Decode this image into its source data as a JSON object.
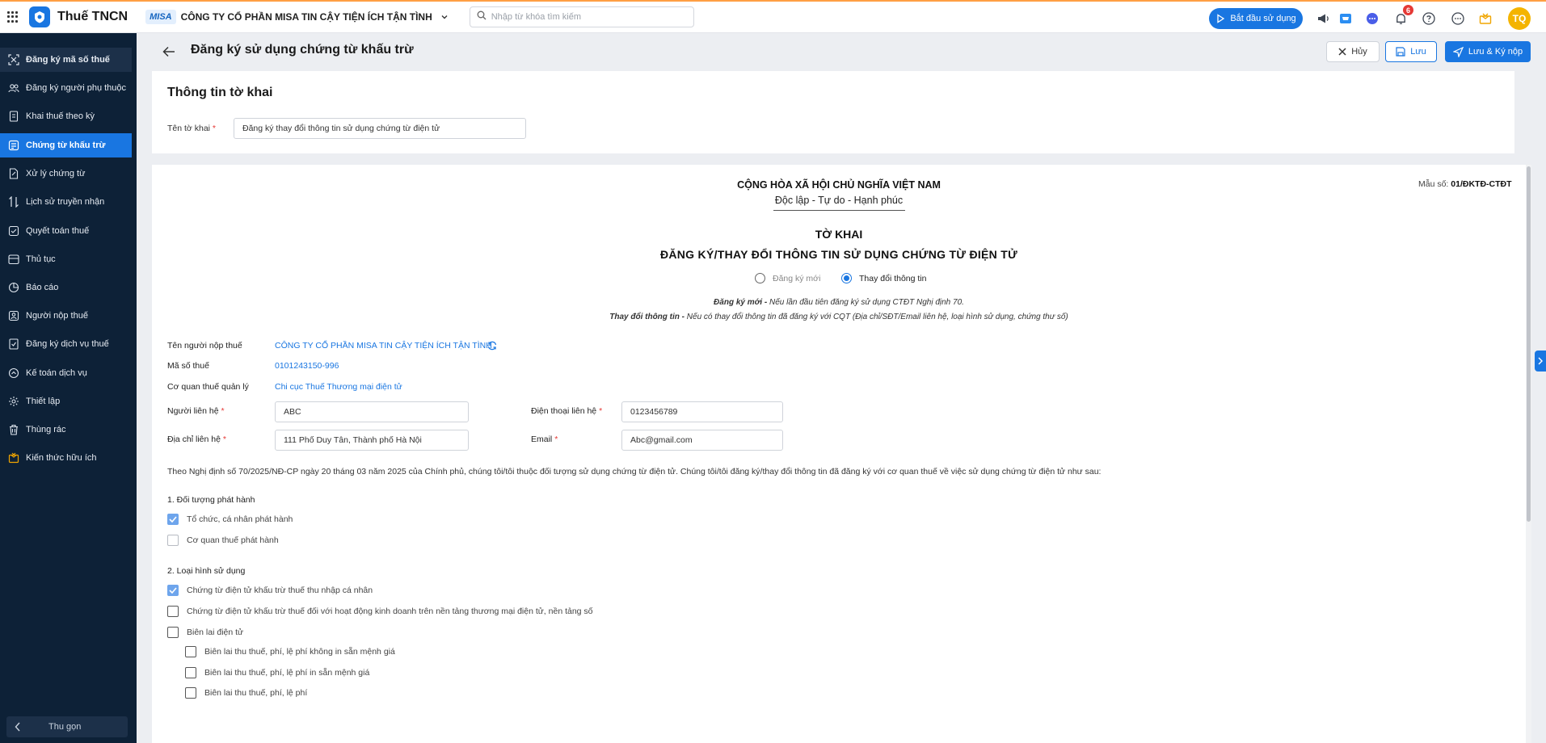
{
  "app": {
    "name": "Thuế TNCN",
    "brand_tag": "MISA",
    "company": "CÔNG TY CỔ PHẦN MISA TIN CẬY TIỆN ÍCH TẬN TÌNH",
    "search_placeholder": "Nhập từ khóa tìm kiếm",
    "start_button": "Bắt đầu sử dụng",
    "notification_count": "6",
    "avatar_initials": "TQ",
    "accent_color": "#1976e1"
  },
  "sidebar": {
    "items": [
      {
        "label": "Đăng ký mã số thuế",
        "icon": "id-card-icon"
      },
      {
        "label": "Đăng ký người phụ thuộc",
        "icon": "users-icon"
      },
      {
        "label": "Khai thuế theo kỳ",
        "icon": "document-icon"
      },
      {
        "label": "Chứng từ khấu trừ",
        "icon": "receipt-icon"
      },
      {
        "label": "Xử lý chứng từ",
        "icon": "file-edit-icon"
      },
      {
        "label": "Lịch sử truyền nhận",
        "icon": "transfer-icon"
      },
      {
        "label": "Quyết toán thuế",
        "icon": "settlement-icon"
      },
      {
        "label": "Thủ tục",
        "icon": "folder-icon"
      },
      {
        "label": "Báo cáo",
        "icon": "chart-icon"
      },
      {
        "label": "Người nộp thuế",
        "icon": "person-icon"
      },
      {
        "label": "Đăng ký dịch vụ thuế",
        "icon": "service-icon"
      },
      {
        "label": "Kế toán dịch vụ",
        "icon": "accounting-icon"
      },
      {
        "label": "Thiết lập",
        "icon": "gear-icon"
      },
      {
        "label": "Thùng rác",
        "icon": "trash-icon"
      },
      {
        "label": "Kiến thức hữu ích",
        "icon": "knowledge-icon"
      }
    ],
    "collapse_label": "Thu gọn"
  },
  "header": {
    "title": "Đăng ký sử dụng chứng từ khấu trừ",
    "cancel": "Hủy",
    "save": "Lưu",
    "save_sign": "Lưu & Ký nộp"
  },
  "info": {
    "title": "Thông tin tờ khai",
    "name_label": "Tên tờ khai",
    "name_value": "Đăng ký thay đổi thông tin sử dụng chứng từ điện tử"
  },
  "form": {
    "nation": "CỘNG HÒA XÃ HỘI CHỦ NGHĨA VIỆT NAM",
    "motto": "Độc lập - Tự do - Hạnh phúc",
    "form_code_label": "Mẫu số:",
    "form_code": "01/ĐKTĐ-CTĐT",
    "title": "TỜ KHAI",
    "subtitle": "ĐĂNG KÝ/THAY ĐỔI THÔNG TIN SỬ DỤNG CHỨNG TỪ ĐIỆN TỬ",
    "radio_new": "Đăng ký mới",
    "radio_change": "Thay đổi thông tin",
    "note1_bold": "Đăng ký mới -",
    "note1": "Nếu lần đầu tiên đăng ký sử dụng CTĐT Nghị định 70.",
    "note2_bold": "Thay đổi thông tin -",
    "note2": "Nếu có thay đổi thông tin đã đăng ký với CQT (Địa chỉ/SĐT/Email liên hệ, loại hình sử dụng, chứng thư số)",
    "taxpayer_label": "Tên người nộp thuế",
    "taxpayer_value": "CÔNG TY CỔ PHẦN MISA TIN CẬY TIỆN ÍCH TẬN TÌNH",
    "tax_code_label": "Mã số thuế",
    "tax_code_value": "0101243150-996",
    "authority_label": "Cơ quan thuế quản lý",
    "authority_value": "Chi cục Thuế Thương mại điện tử",
    "contact_label": "Người liên hệ",
    "contact_value": "ABC",
    "phone_label": "Điện thoại liên hệ",
    "phone_value": "0123456789",
    "address_label": "Địa chỉ liên hệ",
    "address_value": "111 Phố Duy Tân, Thành phố Hà Nội",
    "email_label": "Email",
    "email_value": "Abc@gmail.com",
    "statement": "Theo Nghị định số 70/2025/NĐ-CP ngày 20 tháng 03 năm 2025 của Chính phủ, chúng tôi/tôi thuộc đối tượng sử dụng chứng từ điện tử. Chúng tôi/tôi đăng ký/thay đổi thông tin đã đăng ký với cơ quan thuế về việc sử dụng chứng từ điện tử như sau:",
    "section1": "1. Đối tượng phát hành",
    "s1_opt1": "Tổ chức, cá nhân phát hành",
    "s1_opt2": "Cơ quan thuế phát hành",
    "section2": "2. Loại hình sử dụng",
    "s2_opt1": "Chứng từ điện tử khấu trừ thuế thu nhập cá nhân",
    "s2_opt2": "Chứng từ điện tử khấu trừ thuế đối với hoạt động kinh doanh trên nền tảng thương mại điện tử, nền tảng số",
    "s2_opt3": "Biên lai điện tử",
    "s2_sub1": "Biên lai thu thuế, phí, lệ phí không in sẵn mệnh giá",
    "s2_sub2": "Biên lai thu thuế, phí, lệ phí in sẵn mệnh giá",
    "s2_sub3": "Biên lai thu thuế, phí, lệ phí"
  }
}
